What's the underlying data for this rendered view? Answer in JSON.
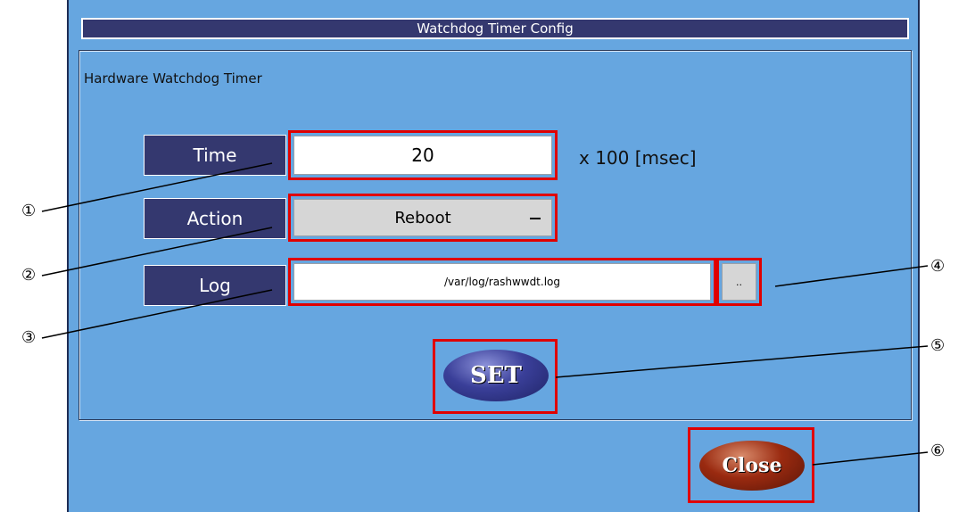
{
  "window": {
    "title": "Watchdog Timer Config"
  },
  "group": {
    "title": "Hardware Watchdog Timer"
  },
  "time": {
    "label": "Time",
    "value": "20",
    "unit": "x 100 [msec]"
  },
  "action": {
    "label": "Action",
    "selected": "Reboot"
  },
  "log": {
    "label": "Log",
    "path": "/var/log/rashwwdt.log",
    "browse_label": ".."
  },
  "buttons": {
    "set_label": "SET",
    "close_label": "Close"
  },
  "callouts": [
    "①",
    "②",
    "③",
    "④",
    "⑤",
    "⑥"
  ],
  "colors": {
    "window_bg": "#66a6e0",
    "label_bg": "#34386f",
    "highlight": "#e00000"
  }
}
